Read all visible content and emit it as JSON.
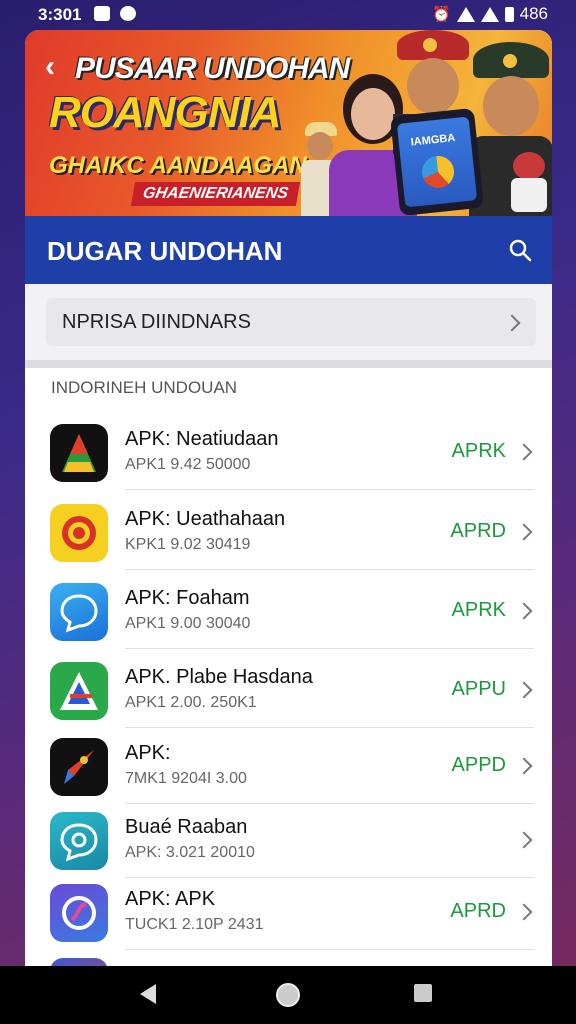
{
  "status_bar": {
    "time": "3:301",
    "right_text": "486"
  },
  "banner": {
    "title_line1": "PUSAAR UNDOHAN",
    "title_line2": "ROANGNIA",
    "title_line3": "GHAIKC AANDAAGAN",
    "ribbon": "GHAENIERIANENS",
    "phone_label": "IAMGBA"
  },
  "header": {
    "title": "DUGAR UNDOHAN"
  },
  "select": {
    "label": "NPRISA DIINDNARS"
  },
  "section": {
    "caption": "INDORINEH UNDOUAN"
  },
  "apps": [
    {
      "name": "APK: Neatiudaan",
      "sub": "APK1 9.42 50000",
      "status": "APRK",
      "icon": "a-letter-icon"
    },
    {
      "name": "APK: Ueathahaan",
      "sub": "KPK1 9.02 30419",
      "status": "APRD",
      "icon": "red-mascot-icon"
    },
    {
      "name": "APK: Foaham",
      "sub": "APK1 9.00 30040",
      "status": "APRK",
      "icon": "chat-bubble-icon"
    },
    {
      "name": "APK. Plabe Hasdana",
      "sub": "APK1 2.00. 250K1",
      "status": "APPU",
      "icon": "a-triangle-icon"
    },
    {
      "name": "APK:",
      "sub": "7MK1 9204I 3.00",
      "status": "APPD",
      "icon": "rocket-icon"
    },
    {
      "name": "Buaé Raaban",
      "sub": "APK: 3.021 20010",
      "status": "",
      "icon": "chat-search-icon"
    },
    {
      "name": "APK: APK",
      "sub": "TUCK1 2.10P 2431",
      "status": "APRD",
      "icon": "s-swirl-icon"
    }
  ]
}
